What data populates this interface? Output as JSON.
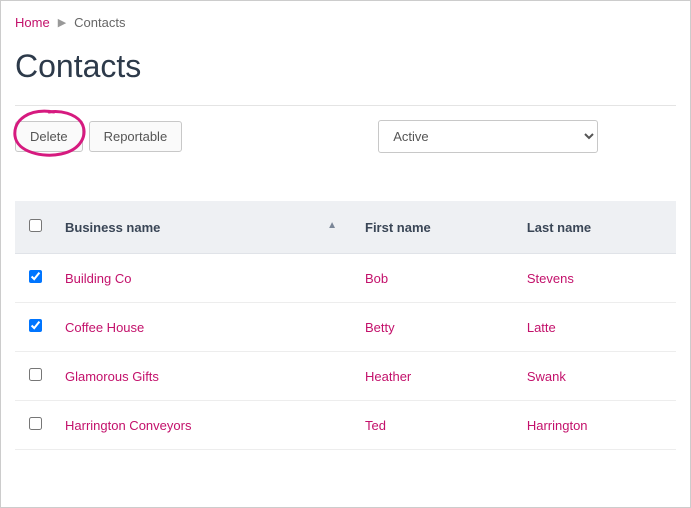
{
  "breadcrumb": {
    "home": "Home",
    "current": "Contacts"
  },
  "title": "Contacts",
  "toolbar": {
    "delete_label": "Delete",
    "reportable_label": "Reportable"
  },
  "filter": {
    "selected": "Active"
  },
  "table": {
    "headers": {
      "business": "Business name",
      "first": "First name",
      "last": "Last name"
    },
    "rows": [
      {
        "checked": true,
        "business": "Building Co",
        "first": "Bob",
        "last": "Stevens"
      },
      {
        "checked": true,
        "business": "Coffee House",
        "first": "Betty",
        "last": "Latte"
      },
      {
        "checked": false,
        "business": "Glamorous Gifts",
        "first": "Heather",
        "last": "Swank"
      },
      {
        "checked": false,
        "business": "Harrington Conveyors",
        "first": "Ted",
        "last": "Harrington"
      }
    ]
  }
}
